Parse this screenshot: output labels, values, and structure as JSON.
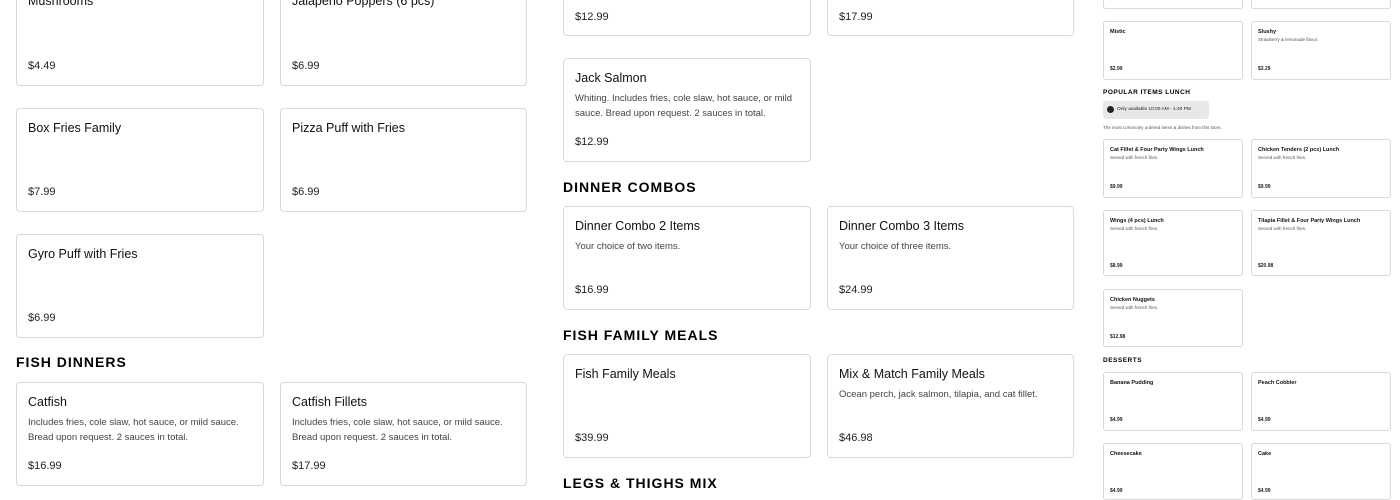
{
  "left_col": {
    "mushrooms": {
      "title": "Mushrooms",
      "price": "$4.49"
    },
    "jalapeno": {
      "title": "Jalapeno Poppers (6 pcs)",
      "price": "$6.99"
    },
    "box_fries": {
      "title": "Box Fries Family",
      "price": "$7.99"
    },
    "pizza_puff": {
      "title": "Pizza Puff with Fries",
      "price": "$6.99"
    },
    "gyro_puff": {
      "title": "Gyro Puff with Fries",
      "price": "$6.99"
    }
  },
  "fish_dinners": {
    "heading": "FISH DINNERS",
    "catfish": {
      "title": "Catfish",
      "desc": "Includes fries, cole slaw, hot sauce, or mild sauce. Bread upon request. 2 sauces in total.",
      "price": "$16.99"
    },
    "catfish_fillets": {
      "title": "Catfish Fillets",
      "desc": "Includes fries, cole slaw, hot sauce, or mild sauce. Bread upon request. 2 sauces in total.",
      "price": "$17.99"
    }
  },
  "mid_col": {
    "top1_price": "$12.99",
    "top2_price": "$17.99",
    "jack_salmon": {
      "title": "Jack Salmon",
      "desc": "Whiting. Includes fries, cole slaw, hot sauce, or mild sauce. Bread upon request. 2 sauces in total.",
      "price": "$12.99"
    },
    "dinner_combos_heading": "DINNER COMBOS",
    "combo2": {
      "title": "Dinner Combo 2 Items",
      "desc": "Your choice of two items.",
      "price": "$16.99"
    },
    "combo3": {
      "title": "Dinner Combo 3 Items",
      "desc": "Your choice of three items.",
      "price": "$24.99"
    },
    "fish_family_heading": "FISH FAMILY MEALS",
    "fish_family": {
      "title": "Fish Family Meals",
      "price": "$39.99"
    },
    "mix_match": {
      "title": "Mix & Match Family Meals",
      "desc": "Ocean perch, jack salmon, tilapia, and cat fillet.",
      "price": "$46.98"
    },
    "legs_heading": "LEGS & THIGHS MIX"
  },
  "right_panel": {
    "mistic": {
      "title": "Mistic",
      "price": "$2.99"
    },
    "slushy": {
      "title": "Slushy",
      "desc": "Strawberry & lemonade flavor.",
      "price": "$3.29"
    },
    "popular_heading": "POPULAR ITEMS LUNCH",
    "availability": "Only available 10:00 AM - 1:40 PM",
    "note": "The most commonly ordered items & dishes from this store.",
    "items": [
      {
        "title": "Cat Fillet & Four Party Wings Lunch",
        "desc": "Served with french fries.",
        "price": "$9.99"
      },
      {
        "title": "Chicken Tenders (2 pcs) Lunch",
        "desc": "Served with french fries.",
        "price": "$9.99"
      },
      {
        "title": "Wings (4 pcs) Lunch",
        "desc": "Served with french fries.",
        "price": "$8.99"
      },
      {
        "title": "Tilapia Fillet & Four Party Wings Lunch",
        "desc": "Served with french fries.",
        "price": "$20.98"
      },
      {
        "title": "Chicken Nuggets",
        "desc": "Served with french fries.",
        "price": "$12.98"
      }
    ],
    "desserts_heading": "DESSERTS",
    "desserts": [
      {
        "title": "Banana Pudding",
        "price": "$4.99"
      },
      {
        "title": "Peach Cobbler",
        "price": "$4.99"
      },
      {
        "title": "Cheesecake",
        "price": "$4.99"
      },
      {
        "title": "Cake",
        "price": "$4.99"
      }
    ]
  }
}
